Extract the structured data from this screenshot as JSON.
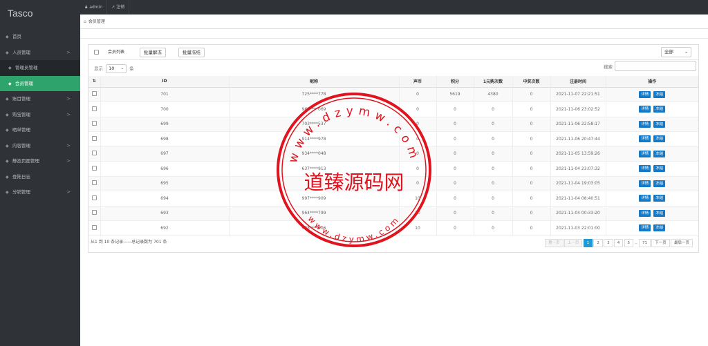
{
  "app": {
    "brand": "Tasco"
  },
  "topbar": {
    "user": "admin",
    "logout": "注销"
  },
  "sidebar": {
    "items": [
      {
        "label": "首页",
        "chevron": ""
      },
      {
        "label": "人员管理",
        "chevron": ">"
      },
      {
        "label": "管理员管理",
        "chevron": ""
      },
      {
        "label": "会员管理",
        "chevron": ""
      },
      {
        "label": "账目管理",
        "chevron": ">"
      },
      {
        "label": "购宝管理",
        "chevron": ">"
      },
      {
        "label": "晒单管理",
        "chevron": ""
      },
      {
        "label": "内容管理",
        "chevron": ">"
      },
      {
        "label": "静态页面管理",
        "chevron": ">"
      },
      {
        "label": "登陆日志",
        "chevron": ""
      },
      {
        "label": "分销管理",
        "chevron": ">"
      }
    ]
  },
  "breadcrumb": {
    "label": "会员管理"
  },
  "toolbar": {
    "title": "会员列表",
    "unfreeze": "批量解冻",
    "freeze": "批量冻结",
    "filter_value": "全部"
  },
  "length": {
    "prefix": "显示",
    "value": "10",
    "suffix": "条"
  },
  "search": {
    "label": "搜索"
  },
  "table": {
    "headers": [
      "ID",
      "昵称",
      "声币",
      "积分",
      "1元购次数",
      "中奖次数",
      "注册时间",
      "操作"
    ],
    "rows": [
      {
        "id": "701",
        "nick": "725****778",
        "coin": "0",
        "points": "5619",
        "buys": "4380",
        "wins": "0",
        "reg": "2021-11-07 22:21:51"
      },
      {
        "id": "700",
        "nick": "962****069",
        "coin": "0",
        "points": "0",
        "buys": "0",
        "wins": "0",
        "reg": "2021-11-06 23:02:52"
      },
      {
        "id": "699",
        "nick": "703****537",
        "coin": "0",
        "points": "0",
        "buys": "0",
        "wins": "0",
        "reg": "2021-11-06 22:58:17"
      },
      {
        "id": "698",
        "nick": "914****978",
        "coin": "0",
        "points": "0",
        "buys": "0",
        "wins": "0",
        "reg": "2021-11-06 20:47:44"
      },
      {
        "id": "697",
        "nick": "934****048",
        "coin": "0",
        "points": "0",
        "buys": "0",
        "wins": "0",
        "reg": "2021-11-05 13:59:26"
      },
      {
        "id": "696",
        "nick": "637****913",
        "coin": "0",
        "points": "0",
        "buys": "0",
        "wins": "0",
        "reg": "2021-11-04 23:07:32"
      },
      {
        "id": "695",
        "nick": "",
        "coin": "0",
        "points": "0",
        "buys": "0",
        "wins": "0",
        "reg": "2021-11-04 19:03:05"
      },
      {
        "id": "694",
        "nick": "997****909",
        "coin": "10",
        "points": "0",
        "buys": "0",
        "wins": "0",
        "reg": "2021-11-04 08:40:51"
      },
      {
        "id": "693",
        "nick": "964****799",
        "coin": "10",
        "points": "0",
        "buys": "0",
        "wins": "0",
        "reg": "2021-11-04 00:33:20"
      },
      {
        "id": "692",
        "nick": "938****906",
        "coin": "10",
        "points": "0",
        "buys": "0",
        "wins": "0",
        "reg": "2021-11-03 22:01:00"
      }
    ],
    "detail_label": "详情",
    "freeze_label": "冻结"
  },
  "info": {
    "text": "从1 到 10 条记录——总记录数为 701 条"
  },
  "pagination": {
    "first": "第一页",
    "prev": "上一页",
    "pages": [
      "1",
      "2",
      "3",
      "4",
      "5"
    ],
    "ellipsis": "..",
    "last_page": "71",
    "next": "下一页",
    "last": "最后一页"
  },
  "watermark": {
    "text": "道臻源码网",
    "ring_top": "www.dzymw.com",
    "ring_bottom": "www.dzymw.com",
    "color": "#e0141e"
  },
  "colors": {
    "sidebar_bg": "#2f3337",
    "active": "#2ea46c",
    "button_blue": "#1479c6",
    "page_current": "#1e9bd7"
  }
}
